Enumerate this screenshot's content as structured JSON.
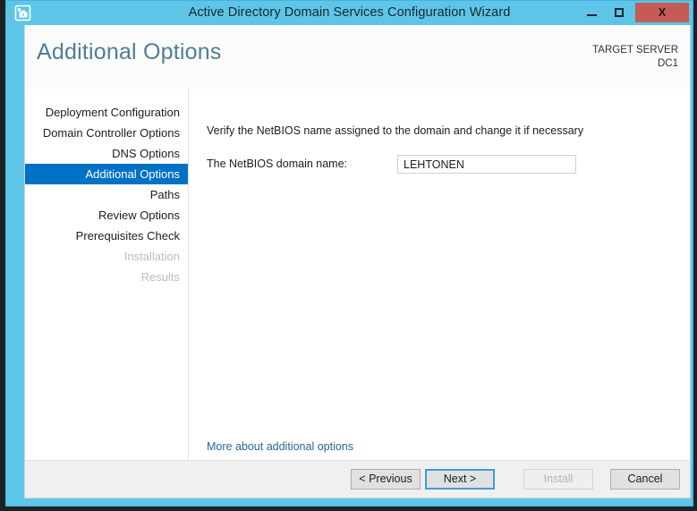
{
  "window": {
    "title": "Active Directory Domain Services Configuration Wizard",
    "icon": "server-wizard-icon",
    "minimize_label": "Minimize",
    "maximize_label": "Maximize",
    "close_label": "X",
    "accent_color": "#5ec5e8",
    "close_color": "#c45b55"
  },
  "header": {
    "page_title": "Additional Options",
    "target_server_label": "TARGET SERVER",
    "target_server_name": "DC1",
    "title_color": "#4e7f92"
  },
  "sidebar": {
    "selected_color": "#0072c6",
    "items": [
      {
        "label": "Deployment Configuration",
        "state": "enabled"
      },
      {
        "label": "Domain Controller Options",
        "state": "enabled"
      },
      {
        "label": "DNS Options",
        "state": "enabled"
      },
      {
        "label": "Additional Options",
        "state": "selected"
      },
      {
        "label": "Paths",
        "state": "enabled"
      },
      {
        "label": "Review Options",
        "state": "enabled"
      },
      {
        "label": "Prerequisites Check",
        "state": "enabled"
      },
      {
        "label": "Installation",
        "state": "disabled"
      },
      {
        "label": "Results",
        "state": "disabled"
      }
    ]
  },
  "content": {
    "instruction": "Verify the NetBIOS name assigned to the domain and change it if necessary",
    "netbios_label": "The NetBIOS domain name:",
    "netbios_value": "LEHTONEN",
    "netbios_placeholder": "",
    "more_link": "More about additional options",
    "link_color": "#2a6496"
  },
  "footer": {
    "previous_label": "< Previous",
    "next_label": "Next >",
    "install_label": "Install",
    "cancel_label": "Cancel",
    "install_enabled": false,
    "focus_color": "#3c9fda"
  }
}
